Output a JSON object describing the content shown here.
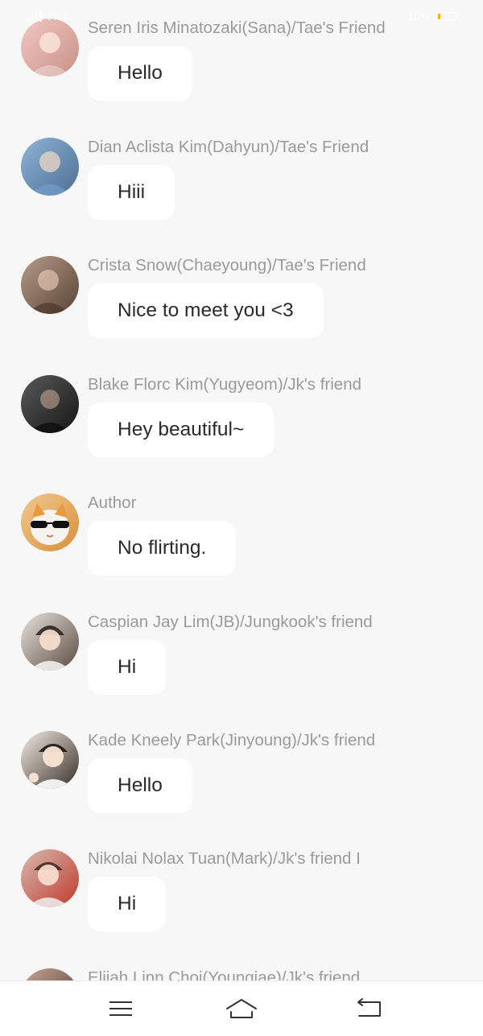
{
  "status_bar": {
    "time": "9:54",
    "battery": "10%"
  },
  "messages": [
    {
      "sender": "Seren Iris Minatozaki(Sana)/Tae's Friend",
      "text": "Hello",
      "avatar_icon": "avatar-photo-icon",
      "colors": [
        "#f0c9c2",
        "#c98f86"
      ]
    },
    {
      "sender": "Dian Aclista Kim(Dahyun)/Tae's Friend",
      "text": "Hiii",
      "avatar_icon": "avatar-photo-icon",
      "colors": [
        "#8db4d6",
        "#4d6f92"
      ]
    },
    {
      "sender": "Crista Snow(Chaeyoung)/Tae's Friend",
      "text": "Nice to meet you <3",
      "avatar_icon": "avatar-photo-icon",
      "colors": [
        "#b59a86",
        "#5b4437"
      ]
    },
    {
      "sender": "Blake Florc Kim(Yugyeom)/Jk's friend",
      "text": "Hey beautiful~",
      "avatar_icon": "avatar-photo-icon",
      "colors": [
        "#5a5a5a",
        "#161616"
      ]
    },
    {
      "sender": "Author",
      "text": "No flirting.",
      "avatar_icon": "cat-sunglasses-icon",
      "colors": [
        "#f1c98f",
        "#d88f3a"
      ]
    },
    {
      "sender": "Caspian Jay Lim(JB)/Jungkook's friend",
      "text": "Hi",
      "avatar_icon": "avatar-photo-icon",
      "colors": [
        "#e9e4de",
        "#5a4a40"
      ]
    },
    {
      "sender": "Kade Kneely Park(Jinyoung)/Jk's friend",
      "text": "Hello",
      "avatar_icon": "avatar-photo-icon",
      "colors": [
        "#f2ece4",
        "#3b2e28"
      ]
    },
    {
      "sender": "Nikolai Nolax Tuan(Mark)/Jk's friend I",
      "text": "Hi",
      "avatar_icon": "avatar-photo-icon",
      "colors": [
        "#d8b9b0",
        "#c0392b"
      ]
    },
    {
      "sender": "Elijah Linn Choi(Youngjae)/Jk's friend",
      "text": "",
      "avatar_icon": "avatar-photo-icon",
      "colors": [
        "#c9a895",
        "#4a3228"
      ]
    }
  ],
  "nav_bar": {
    "menu_icon": "menu-icon",
    "home_icon": "home-icon",
    "back_icon": "back-icon"
  }
}
